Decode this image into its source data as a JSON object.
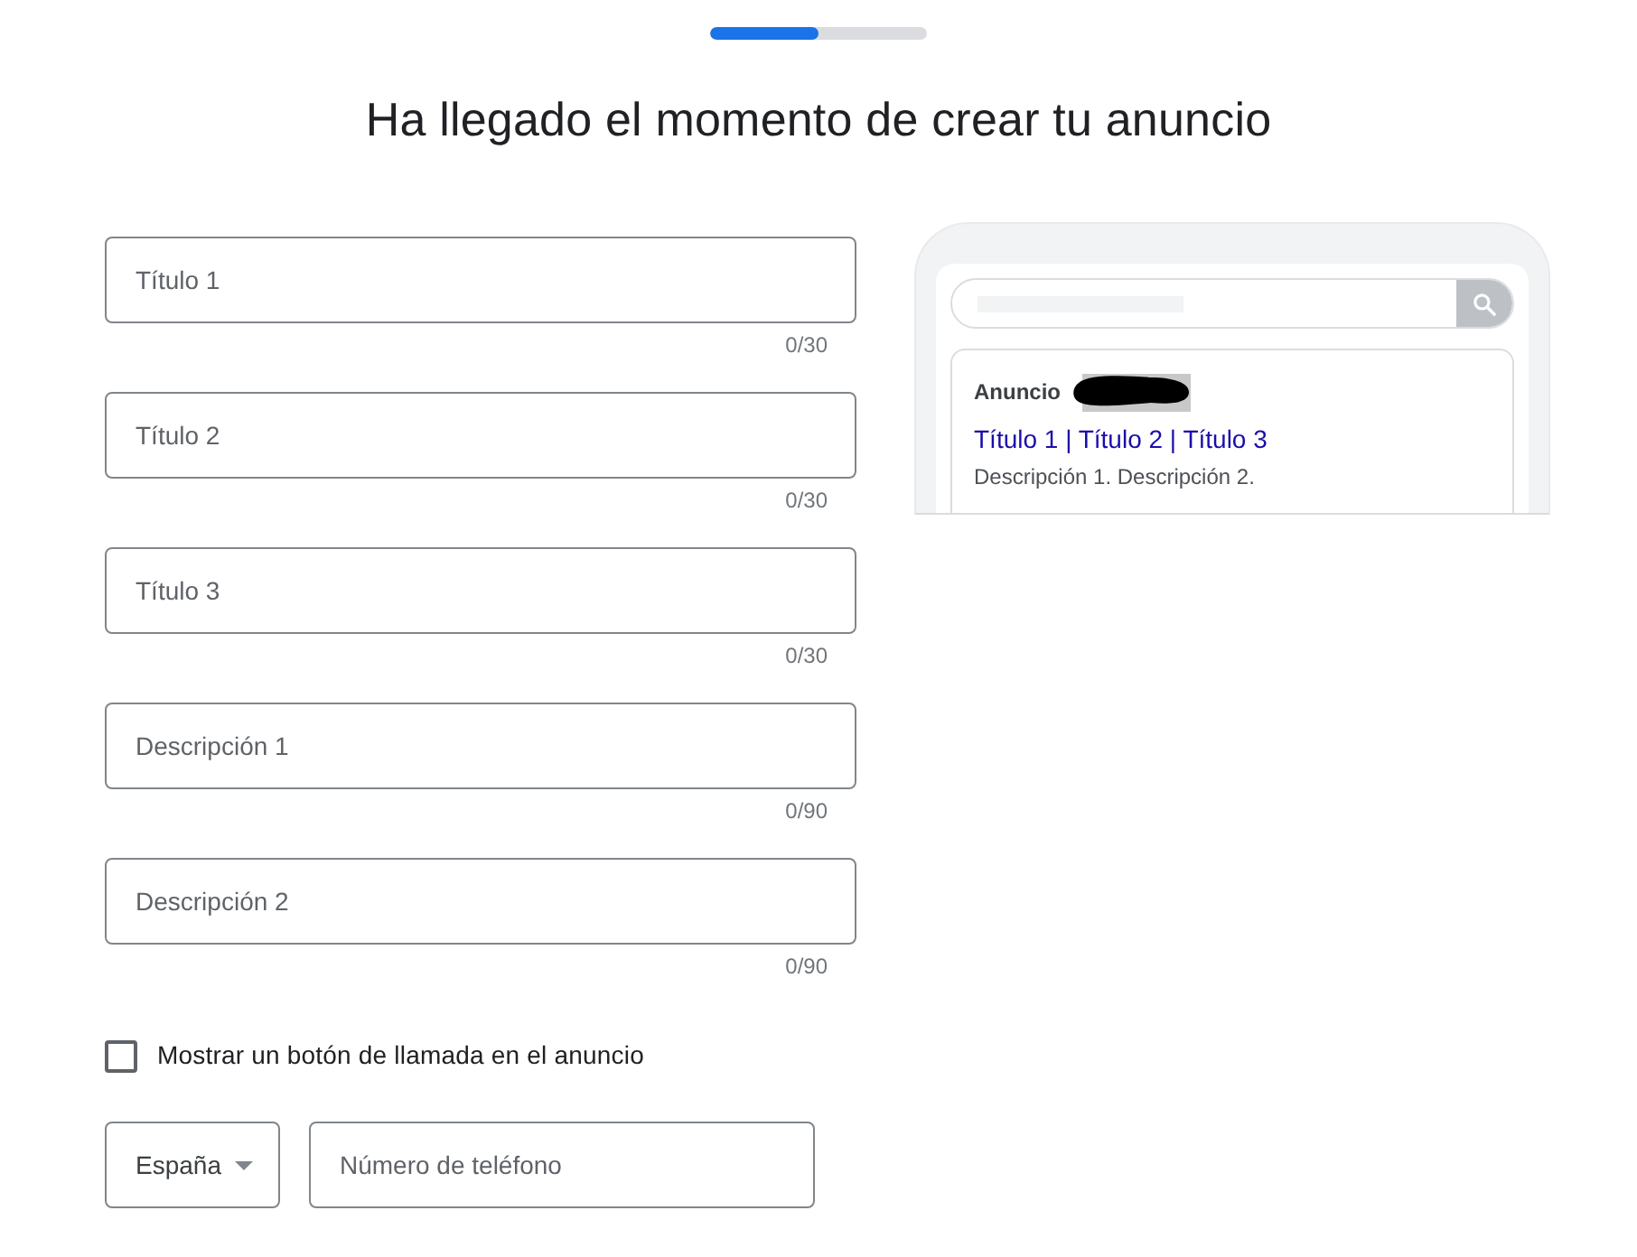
{
  "progress": {
    "level": 0.5
  },
  "title": "Ha llegado el momento de crear tu anuncio",
  "fields": [
    {
      "placeholder": "Título 1",
      "counter": "0/30"
    },
    {
      "placeholder": "Título 2",
      "counter": "0/30"
    },
    {
      "placeholder": "Título 3",
      "counter": "0/30"
    },
    {
      "placeholder": "Descripción 1",
      "counter": "0/90"
    },
    {
      "placeholder": "Descripción 2",
      "counter": "0/90"
    }
  ],
  "call_button": {
    "label": "Mostrar un botón de llamada en el anuncio",
    "checked": false
  },
  "phone": {
    "country": "España",
    "placeholder": "Número de teléfono"
  },
  "preview": {
    "ad_label": "Anuncio",
    "headline": "Título 1 | Título 2 | Título 3",
    "description": "Descripción 1. Descripción 2."
  }
}
